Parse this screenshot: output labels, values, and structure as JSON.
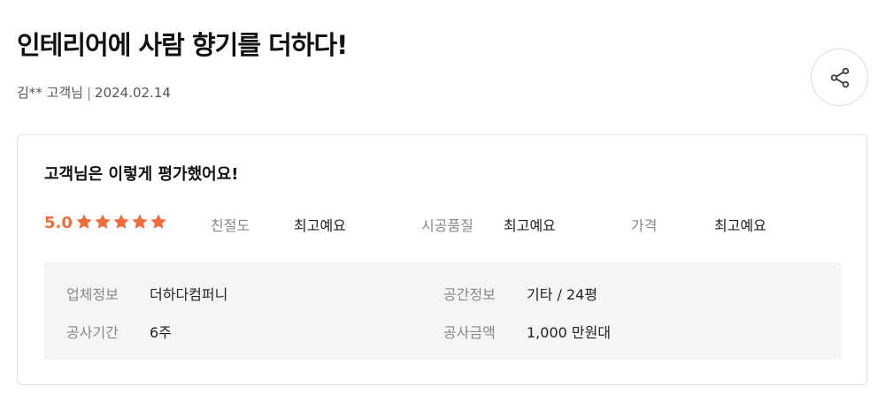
{
  "review": {
    "title": "인테리어에 사람 향기를 더하다!",
    "author": "김** 고객님",
    "date": "2024.02.14",
    "separator": "|"
  },
  "share": {
    "icon": "share-icon"
  },
  "evaluation": {
    "heading": "고객님은 이렇게 평가했어요!",
    "score": "5.0",
    "stars": 5,
    "star_color": "#f26b3a",
    "ratings": [
      {
        "label": "친절도",
        "value": "최고예요"
      },
      {
        "label": "시공품질",
        "value": "최고예요"
      },
      {
        "label": "가격",
        "value": "최고예요"
      }
    ]
  },
  "info": {
    "company_label": "업체정보",
    "company_value": "더하다컴퍼니",
    "space_label": "공간정보",
    "space_value": "기타 / 24평",
    "period_label": "공사기간",
    "period_value": "6주",
    "amount_label": "공사금액",
    "amount_value": "1,000 만원대"
  }
}
